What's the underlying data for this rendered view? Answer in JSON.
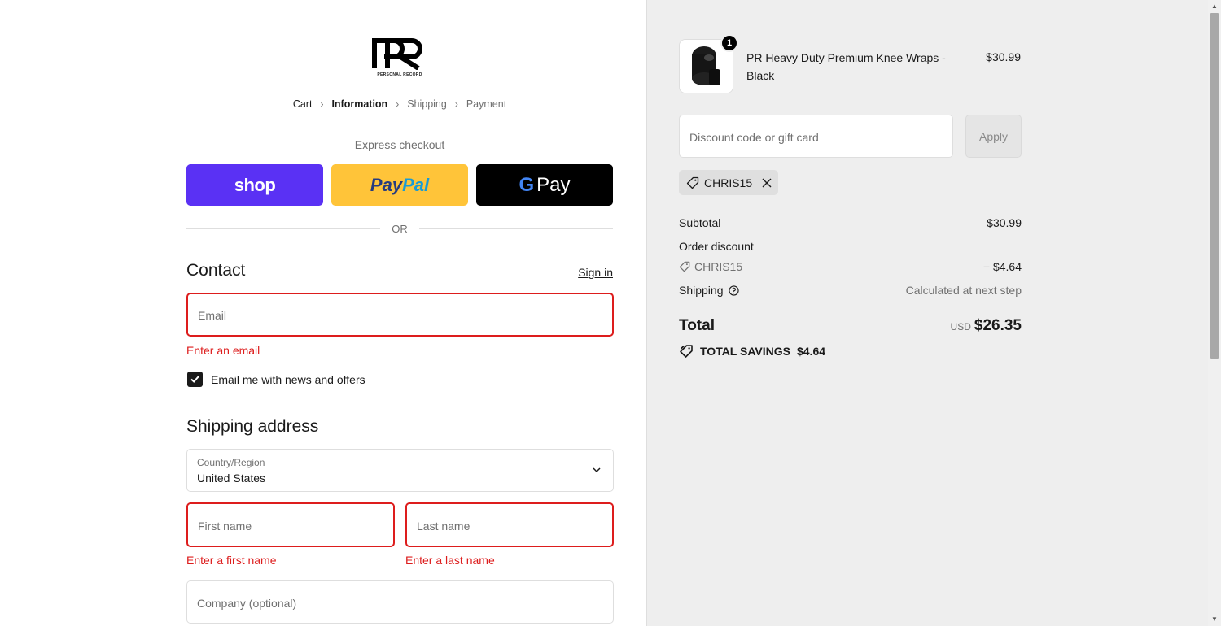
{
  "logo": {
    "brand_mark": "PR",
    "caption": "PERSONAL RECORD"
  },
  "breadcrumb": [
    {
      "label": "Cart",
      "state": "done"
    },
    {
      "label": "Information",
      "state": "active"
    },
    {
      "label": "Shipping",
      "state": "upcoming"
    },
    {
      "label": "Payment",
      "state": "upcoming"
    }
  ],
  "express": {
    "title": "Express checkout",
    "shop_label": "shop",
    "paypal_label_1": "Pay",
    "paypal_label_2": "Pal",
    "gpay_g": "G",
    "gpay_label": "Pay",
    "or_label": "OR"
  },
  "contact": {
    "title": "Contact",
    "signin_label": "Sign in",
    "email_placeholder": "Email",
    "email_error": "Enter an email",
    "newsletter_label": "Email me with news and offers",
    "newsletter_checked": true
  },
  "shipping": {
    "title": "Shipping address",
    "country_label": "Country/Region",
    "country_value": "United States",
    "first_name_placeholder": "First name",
    "first_name_error": "Enter a first name",
    "last_name_placeholder": "Last name",
    "last_name_error": "Enter a last name",
    "company_placeholder": "Company (optional)"
  },
  "summary": {
    "product": {
      "name": "PR Heavy Duty Premium Knee Wraps - Black",
      "price": "$30.99",
      "quantity": "1"
    },
    "discount_placeholder": "Discount code or gift card",
    "apply_label": "Apply",
    "applied_code": "CHRIS15",
    "subtotal_label": "Subtotal",
    "subtotal_value": "$30.99",
    "order_discount_label": "Order discount",
    "discount_code": "CHRIS15",
    "discount_value": "− $4.64",
    "shipping_label": "Shipping",
    "shipping_value": "Calculated at next step",
    "total_label": "Total",
    "currency": "USD",
    "total_value": "$26.35",
    "savings_label": "TOTAL SAVINGS",
    "savings_value": "$4.64"
  },
  "colors": {
    "error": "#dd1d1d",
    "shop_purple": "#5a31f4",
    "paypal_yellow": "#ffc439",
    "summary_bg": "#eeeeee"
  }
}
